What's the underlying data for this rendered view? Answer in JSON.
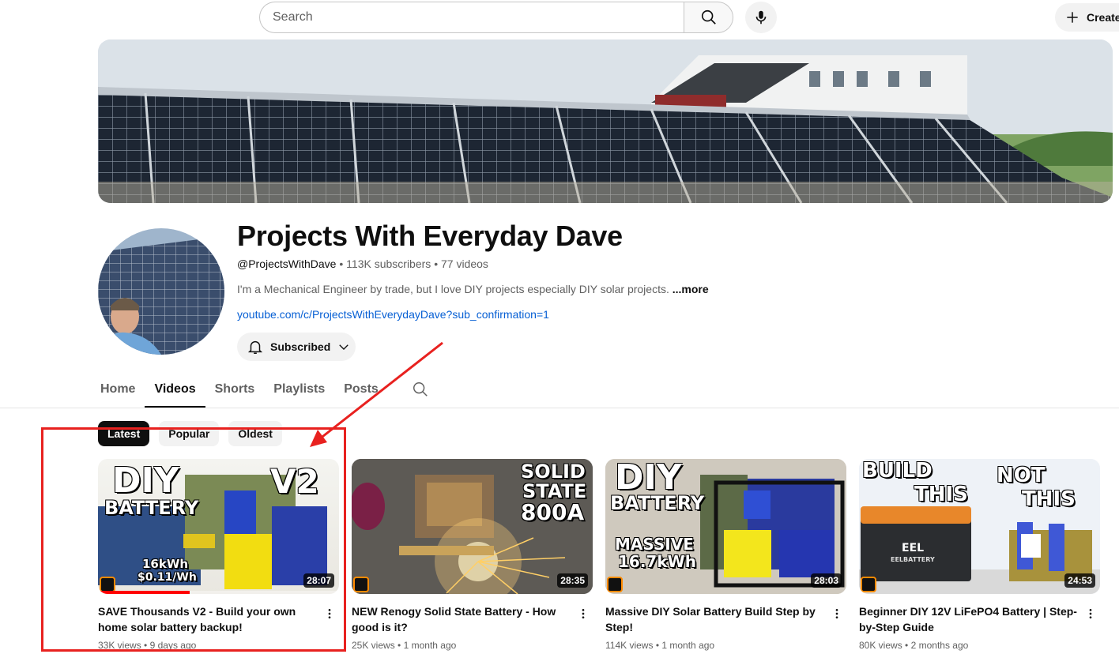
{
  "header": {
    "search_placeholder": "Search",
    "create_label": "Create"
  },
  "channel": {
    "name": "Projects With Everyday Dave",
    "handle": "@ProjectsWithDave",
    "subscribers": "113K subscribers",
    "video_count": "77 videos",
    "description": "I'm a Mechanical Engineer by trade,  but I love DIY projects especially DIY solar projects.",
    "more_label": "...more",
    "link": "youtube.com/c/ProjectsWithEverydayDave?sub_confirmation=1",
    "subscribed_label": "Subscribed"
  },
  "tabs": [
    {
      "label": "Home"
    },
    {
      "label": "Videos"
    },
    {
      "label": "Shorts"
    },
    {
      "label": "Playlists"
    },
    {
      "label": "Posts"
    }
  ],
  "active_tab": "Videos",
  "chips": [
    {
      "label": "Latest"
    },
    {
      "label": "Popular"
    },
    {
      "label": "Oldest"
    }
  ],
  "videos": [
    {
      "title": "SAVE Thousands V2 - Build your own home solar battery backup!",
      "views": "33K views",
      "age": "9 days ago",
      "duration": "28:07",
      "thumb_text": [
        "DIY",
        "BATTERY",
        "V2",
        "16kWh",
        "$0.11/Wh"
      ],
      "watched_fraction": 0.38
    },
    {
      "title": "NEW Renogy Solid State Battery - How good is it?",
      "views": "25K views",
      "age": "1 month ago",
      "duration": "28:35",
      "thumb_text": [
        "SOLID",
        "STATE",
        "800A"
      ]
    },
    {
      "title": "Massive DIY Solar Battery Build Step by Step!",
      "views": "114K views",
      "age": "1 month ago",
      "duration": "28:03",
      "thumb_text": [
        "DIY",
        "BATTERY",
        "MASSIVE",
        "16.7kWh"
      ]
    },
    {
      "title": "Beginner DIY 12V LiFePO4 Battery | Step-by-Step Guide",
      "views": "80K views",
      "age": "2 months ago",
      "duration": "24:53",
      "thumb_text": [
        "BUILD",
        "THIS",
        "NOT",
        "THIS",
        "EEL",
        "EELBATTERY"
      ]
    }
  ],
  "meta_separator": "•",
  "colors": {
    "link": "#065fd4",
    "annotation": "#e8211f",
    "progress": "#ff0000"
  }
}
